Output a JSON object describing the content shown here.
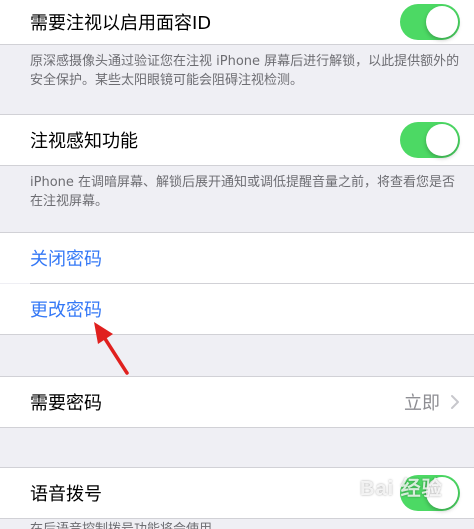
{
  "attention_id": {
    "label": "需要注视以启用面容ID",
    "toggle_on": true,
    "note": "原深感摄像头通过验证您在注视 iPhone 屏幕后进行解锁，以此提供额外的安全保护。某些太阳眼镜可能会阻碍注视检测。"
  },
  "attention_aware": {
    "label": "注视感知功能",
    "toggle_on": true,
    "note": "iPhone 在调暗屏幕、解锁后展开通知或调低提醒音量之前，将查看您是否在注视屏幕。"
  },
  "passcode": {
    "turn_off_label": "关闭密码",
    "change_label": "更改密码"
  },
  "require_passcode": {
    "label": "需要密码",
    "value": "立即"
  },
  "voice_dial": {
    "label": "语音拨号",
    "toggle_on": true,
    "note": "在后语音控制拨号功能将会使用"
  },
  "watermark_text": "Bai 经验",
  "colors": {
    "accent": "#3478f6",
    "toggle_on": "#4cd964",
    "background": "#efeff4",
    "annotation_arrow": "#e0201e"
  }
}
